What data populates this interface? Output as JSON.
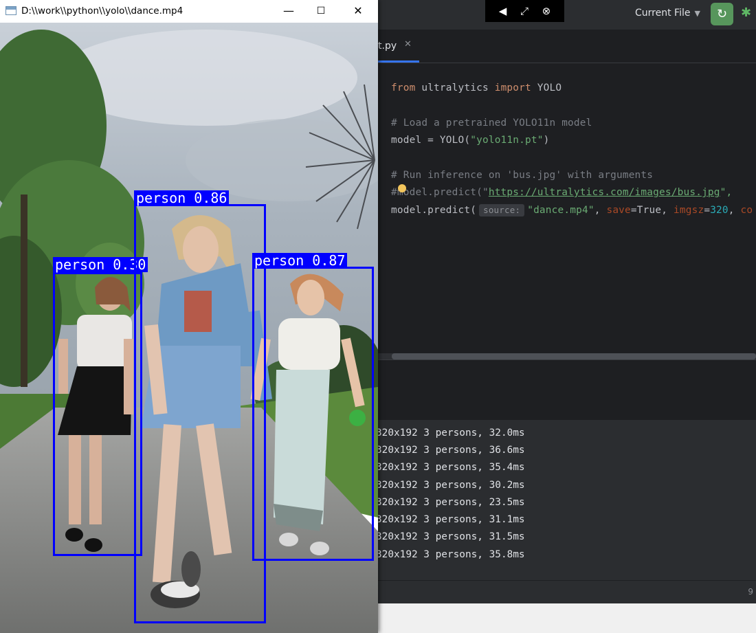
{
  "video_window": {
    "title": "D:\\\\work\\\\python\\\\yolo\\\\dance.mp4",
    "controls": {
      "minimize": "—",
      "maximize": "☐",
      "close": "✕"
    },
    "detections": [
      {
        "label": "person 0.30"
      },
      {
        "label": "person 0.86"
      },
      {
        "label": "person 0.87"
      }
    ]
  },
  "ide": {
    "overlay_toolbar": {
      "icons": [
        "pointer-icon",
        "resize-icon",
        "close-circle-icon"
      ]
    },
    "run_config": {
      "label": "Current File",
      "icon": "chevron-down-icon"
    },
    "tab": {
      "label": "t.py",
      "close": "✕"
    },
    "code": {
      "line1": {
        "kw1": "from",
        "mod": " ultralytics ",
        "kw2": "import",
        "name": " YOLO"
      },
      "line3": "# Load a pretrained YOLO11n model",
      "line4": {
        "pre": "model = YOLO(",
        "str": "\"yolo11n.pt\"",
        "post": ")"
      },
      "line6": "# Run inference on 'bus.jpg' with arguments",
      "line7": {
        "pre": "#model.predict(\"",
        "link": "https://ultralytics.com/images/bus.jpg",
        "post": "\","
      },
      "line8": {
        "pre": "model.predict(",
        "hint": "source:",
        "str": "\"dance.mp4\"",
        "sep1": ", ",
        "p1": "save",
        "eq1": "=True, ",
        "p2": "imgsz",
        "eq2": "=",
        "num": "320",
        "sep2": ", ",
        "p3": "co"
      }
    },
    "console": {
      "lines": [
        "320x192 3 persons, 32.0ms",
        "320x192 3 persons, 36.6ms",
        "320x192 3 persons, 35.4ms",
        "320x192 3 persons, 30.2ms",
        "320x192 3 persons, 23.5ms",
        "320x192 3 persons, 31.1ms",
        "320x192 3 persons, 31.5ms",
        "320x192 3 persons, 35.8ms"
      ]
    },
    "status": {
      "right": "9"
    }
  }
}
